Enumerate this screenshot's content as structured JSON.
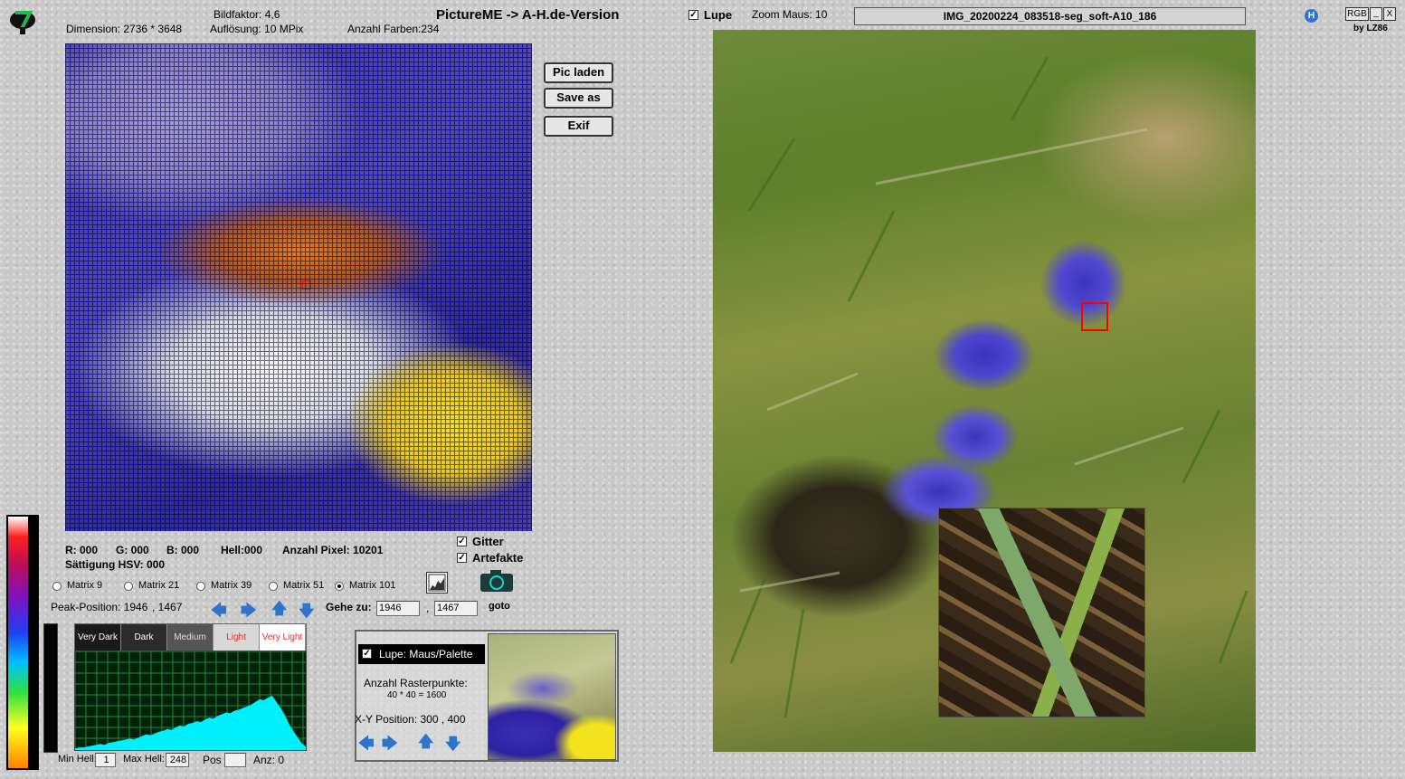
{
  "header": {
    "bildfaktor": "Bildfaktor: 4,6",
    "dimension": "Dimension:  2736 * 3648",
    "aufloesung": "Auflösung: 10 MPix",
    "farben": "Anzahl Farben:234",
    "title": "PictureME -> A-H.de-Version",
    "lupe_label": "Lupe",
    "zoom": "Zoom Maus: 10",
    "filename": "IMG_20200224_083518-seg_soft-A10_186",
    "rgb": "RGB",
    "minimize": "_",
    "close": "X",
    "byline": "by LZ86",
    "help_icon": "H"
  },
  "buttons": {
    "pic_laden": "Pic laden",
    "save_as": "Save as",
    "exif": "Exif"
  },
  "info": {
    "r": "R: 000",
    "g": "G: 000",
    "b": "B: 000",
    "hell": "Hell:000",
    "anzahl_pixel": "Anzahl Pixel: 10201",
    "saettigung": "Sättigung HSV:   000",
    "gitter": "Gitter",
    "artefakte": "Artefakte"
  },
  "matrix": [
    "Matrix 9",
    "Matrix 21",
    "Matrix 39",
    "Matrix 51",
    "Matrix 101"
  ],
  "matrix_selected": 4,
  "peak": {
    "label": "Peak-Position:  1946",
    "y": ",  1467"
  },
  "goto": {
    "label": "Gehe zu:",
    "x": "1946",
    "sep": ",",
    "y": "1467",
    "button": "goto"
  },
  "zones": [
    {
      "label": "Very Dark",
      "color": "#ffffff",
      "bg": "#1a1a1a"
    },
    {
      "label": "Dark",
      "color": "#ffffff",
      "bg": "#2b2b2b"
    },
    {
      "label": "Medium",
      "color": "#dddddd",
      "bg": "#555555"
    },
    {
      "label": "Light",
      "color": "#e0302a",
      "bg": "#d8d8d8"
    },
    {
      "label": "Very Light",
      "color": "#e0302a",
      "bg": "#ffffff"
    }
  ],
  "histogram_footer": {
    "min_label": "Min Hell:",
    "min_val": "1",
    "max_label": "Max Hell:",
    "max_val": "248",
    "pos_label": "Pos",
    "pos_val": "",
    "anz": "Anz:  0"
  },
  "lupe_panel": {
    "checkbox_label": "Lupe: Maus/Palette",
    "raster_label": "Anzahl Rasterpunkte:",
    "raster_val": "40 * 40 = 1600",
    "xy": "X-Y Position:  300 , 400"
  },
  "colors": {
    "accent_blue": "#2f74c9",
    "histogram_bg": "#00220a",
    "histogram_fill": "#00f0ff",
    "marker_red": "#ff0000"
  },
  "histogram": [
    2,
    3,
    3,
    4,
    5,
    6,
    7,
    6,
    8,
    9,
    10,
    11,
    12,
    13,
    12,
    14,
    16,
    18,
    17,
    19,
    21,
    22,
    24,
    23,
    26,
    28,
    27,
    30,
    31,
    33,
    32,
    35,
    37,
    36,
    39,
    41,
    43,
    42,
    45,
    46,
    48,
    50,
    52,
    55,
    58,
    57,
    60,
    62,
    55,
    48,
    40,
    30,
    22,
    15,
    8,
    4
  ]
}
